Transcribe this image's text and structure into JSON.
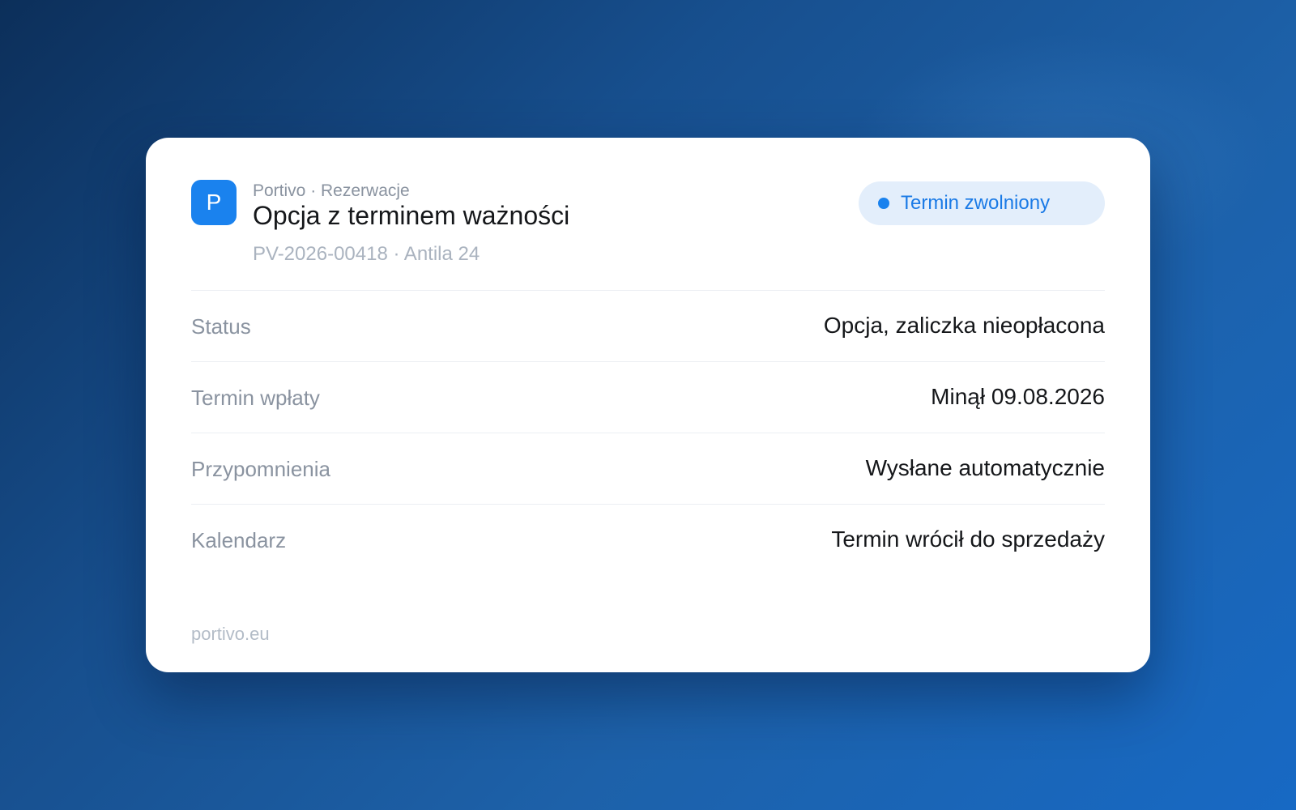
{
  "app": {
    "logo_letter": "P",
    "breadcrumb": "Portivo · Rezerwacje",
    "title": "Opcja z terminem ważności",
    "reference": "PV-2026-00418 · Antila 24"
  },
  "status_badge": {
    "label": "Termin zwolniony",
    "color": "#1a82ee"
  },
  "details": [
    {
      "label": "Status",
      "value": "Opcja, zaliczka nieopłacona"
    },
    {
      "label": "Termin wpłaty",
      "value": "Minął 09.08.2026"
    },
    {
      "label": "Przypomnienia",
      "value": "Wysłane automatycznie"
    },
    {
      "label": "Kalendarz",
      "value": "Termin wrócił do sprzedaży"
    }
  ],
  "footer": {
    "domain": "portivo.eu"
  },
  "colors": {
    "accent": "#1a82ee",
    "badge_bg": "#e3eefb"
  }
}
